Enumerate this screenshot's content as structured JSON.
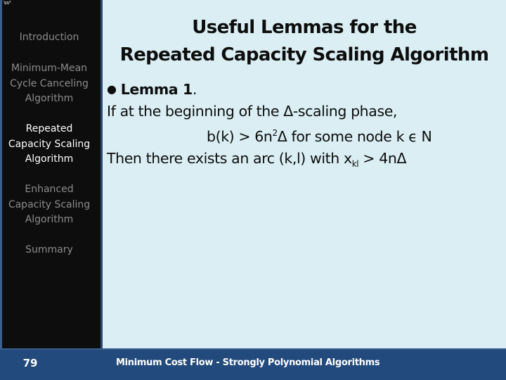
{
  "corner_mark": "′ss²",
  "sidebar": {
    "items": [
      {
        "label_lines": [
          "Introduction"
        ],
        "active": false
      },
      {
        "label_lines": [
          "Minimum-Mean",
          "Cycle Canceling",
          "Algorithm"
        ],
        "active": false
      },
      {
        "label_lines": [
          "Repeated",
          "Capacity Scaling",
          "Algorithm"
        ],
        "active": true
      },
      {
        "label_lines": [
          "Enhanced",
          "Capacity Scaling",
          "Algorithm"
        ],
        "active": false
      },
      {
        "label_lines": [
          "Summary"
        ],
        "active": false
      }
    ]
  },
  "slide": {
    "title_line1": "Useful Lemmas for the",
    "title_line2": "Repeated Capacity Scaling Algorithm",
    "bullet": "●",
    "lemma_label": "Lemma 1",
    "lemma_period": ".",
    "line2": "If at the beginning of the Δ-scaling phase,",
    "line3_a": "b(k) > 6n",
    "line3_sup": "2",
    "line3_b": "Δ for some node k ϵ N",
    "line4_a": "Then there exists an arc (k,l) with x",
    "line4_sub": "kl",
    "line4_b": " > 4nΔ"
  },
  "footer": {
    "page_number": "79",
    "title": "Minimum Cost Flow - Strongly Polynomial Algorithms"
  },
  "colors": {
    "sidebar_bg": "#0d0d0d",
    "content_bg": "#daeef3",
    "footer_bg": "#234a7c",
    "nav_inactive": "#8c8c8c",
    "nav_active": "#ffffff"
  }
}
